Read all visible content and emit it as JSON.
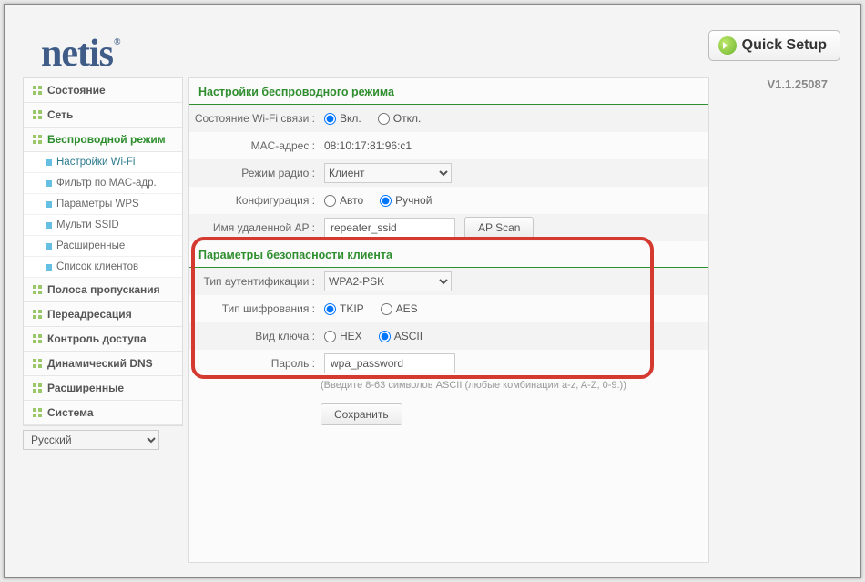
{
  "header": {
    "logo": "netis",
    "quick_setup": "Quick Setup",
    "version": "V1.1.25087"
  },
  "sidebar": {
    "items": [
      {
        "label": "Состояние",
        "active": false
      },
      {
        "label": "Сеть",
        "active": false
      },
      {
        "label": "Беспроводной режим",
        "active": true
      },
      {
        "label": "Полоса пропускания",
        "active": false
      },
      {
        "label": "Переадресация",
        "active": false
      },
      {
        "label": "Контроль доступа",
        "active": false
      },
      {
        "label": "Динамический DNS",
        "active": false
      },
      {
        "label": "Расширенные",
        "active": false
      },
      {
        "label": "Система",
        "active": false
      }
    ],
    "sub_items": [
      {
        "label": "Настройки Wi-Fi",
        "active": true
      },
      {
        "label": "Фильтр по MAC-адр.",
        "active": false
      },
      {
        "label": "Параметры WPS",
        "active": false
      },
      {
        "label": "Мульти SSID",
        "active": false
      },
      {
        "label": "Расширенные",
        "active": false
      },
      {
        "label": "Список клиентов",
        "active": false
      }
    ],
    "language": "Русский"
  },
  "main": {
    "section1_title": "Настройки беспроводного режима",
    "wifi_state_label": "Состояние Wi-Fi связи :",
    "wifi_state_on": "Вкл.",
    "wifi_state_off": "Откл.",
    "mac_label": "MAC-адрес :",
    "mac_value": "08:10:17:81:96:c1",
    "radio_mode_label": "Режим радио :",
    "radio_mode_value": "Клиент",
    "config_label": "Конфигурация :",
    "config_auto": "Авто",
    "config_manual": "Ручной",
    "remote_ap_label": "Имя удаленной AP :",
    "remote_ap_value": "repeater_ssid",
    "ap_scan": "AP Scan",
    "section2_title": "Параметры безопасности клиента",
    "auth_label": "Тип аутентификации :",
    "auth_value": "WPA2-PSK",
    "enc_label": "Тип шифрования :",
    "enc_tkip": "TKIP",
    "enc_aes": "AES",
    "key_type_label": "Вид ключа :",
    "key_hex": "HEX",
    "key_ascii": "ASCII",
    "password_label": "Пароль :",
    "password_value": "wpa_password",
    "password_hint": "(Введите 8-63 символов ASCII (любые комбинации a-z, A-Z, 0-9.))",
    "save": "Сохранить"
  }
}
